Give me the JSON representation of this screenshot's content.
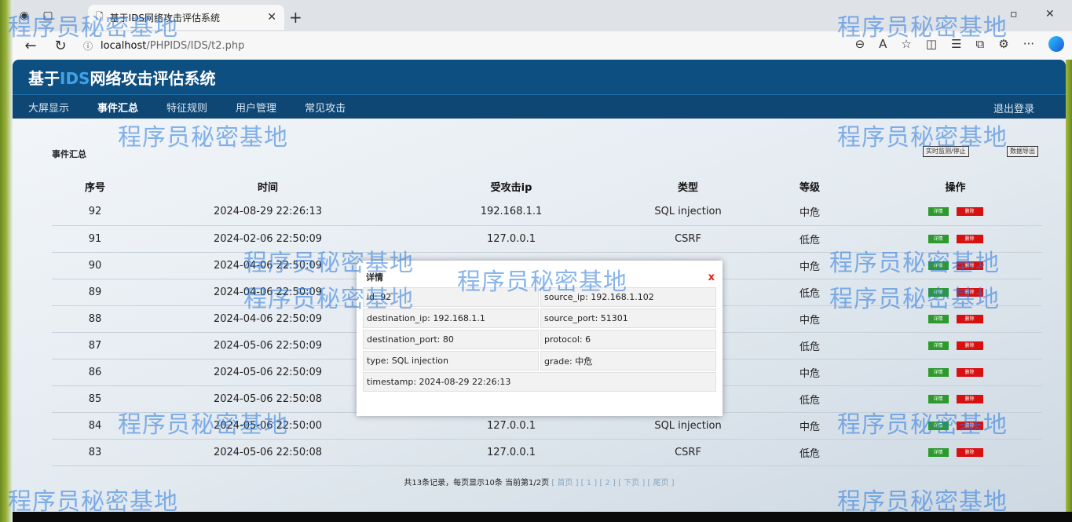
{
  "browser": {
    "tab_title": "基于IDS网络攻击评估系统",
    "url_host": "localhost",
    "url_path": "/PHPIDS/IDS/t2.php",
    "window_close": "✕",
    "new_tab": "+",
    "tab_close": "✕"
  },
  "app": {
    "title_prefix": "基于",
    "title_ids": "IDS",
    "title_suffix": "网络攻击评估系统",
    "menu": [
      "大屏显示",
      "事件汇总",
      "特征规则",
      "用户管理",
      "常见攻击"
    ],
    "active_menu": "事件汇总",
    "logout": "退出登录"
  },
  "section": {
    "title": "事件汇总",
    "btn_realtime": "实时监测/停止",
    "btn_export": "数据导出"
  },
  "table": {
    "headers": [
      "序号",
      "时间",
      "受攻击ip",
      "类型",
      "等级",
      "操作"
    ],
    "rows": [
      {
        "id": "92",
        "time": "2024-08-29 22:26:13",
        "ip": "192.168.1.1",
        "type": "SQL injection",
        "grade": "中危"
      },
      {
        "id": "91",
        "time": "2024-02-06 22:50:09",
        "ip": "127.0.0.1",
        "type": "CSRF",
        "grade": "低危"
      },
      {
        "id": "90",
        "time": "2024-04-06 22:50:09",
        "ip": "",
        "type": "",
        "grade": "中危"
      },
      {
        "id": "89",
        "time": "2024-04-06 22:50:09",
        "ip": "",
        "type": "",
        "grade": "低危"
      },
      {
        "id": "88",
        "time": "2024-04-06 22:50:09",
        "ip": "",
        "type": "",
        "grade": "中危"
      },
      {
        "id": "87",
        "time": "2024-05-06 22:50:09",
        "ip": "",
        "type": "",
        "grade": "低危"
      },
      {
        "id": "86",
        "time": "2024-05-06 22:50:09",
        "ip": "",
        "type": "",
        "grade": "中危"
      },
      {
        "id": "85",
        "time": "2024-05-06 22:50:08",
        "ip": "",
        "type": "",
        "grade": "低危"
      },
      {
        "id": "84",
        "time": "2024-05-06 22:50:00",
        "ip": "127.0.0.1",
        "type": "SQL injection",
        "grade": "中危"
      },
      {
        "id": "83",
        "time": "2024-05-06 22:50:08",
        "ip": "127.0.0.1",
        "type": "CSRF",
        "grade": "低危"
      }
    ],
    "detail_label": "详情",
    "delete_label": "删除"
  },
  "pager": {
    "summary": "共13条记录，每页显示10条 当前第1/2页",
    "links": "[ 首页 ] [ 1 ] [ 2 ] [ 下页 ] [ 尾页 ]"
  },
  "modal": {
    "title": "详情",
    "close": "x",
    "fields": [
      "id: 92",
      "source_ip: 192.168.1.102",
      "destination_ip: 192.168.1.1",
      "source_port: 51301",
      "destination_port: 80",
      "protocol: 6",
      "type: SQL injection",
      "grade: 中危"
    ],
    "timestamp": "timestamp: 2024-08-29 22:26:13"
  },
  "watermark": "程序员秘密基地"
}
